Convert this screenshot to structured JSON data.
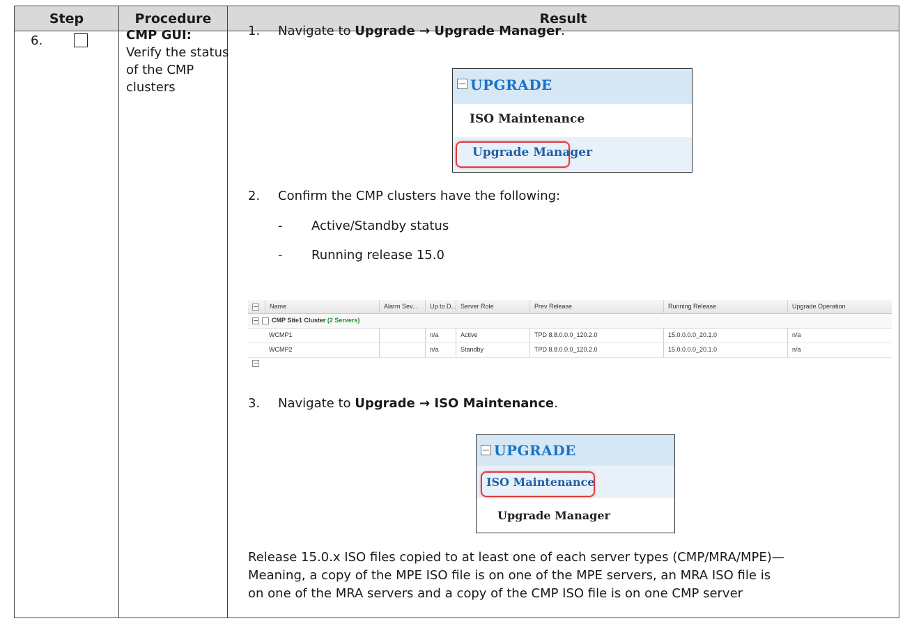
{
  "table": {
    "headers": {
      "step": "Step",
      "procedure": "Procedure",
      "result": "Result"
    }
  },
  "step": {
    "number": "6.",
    "procedure_bold": "CMP GUI:",
    "procedure_rest": "Verify the status of the CMP clusters"
  },
  "result": {
    "s1": {
      "num": "1.",
      "pre": "Navigate to ",
      "b1": "Upgrade",
      "arrow": " → ",
      "b2": "Upgrade Manager",
      "post": "."
    },
    "s2": {
      "num": "2.",
      "text": "Confirm the CMP clusters have the following:"
    },
    "bullets": [
      {
        "dash": "-",
        "text": "Active/Standby status"
      },
      {
        "dash": "-",
        "text": "Running release 15.0"
      }
    ],
    "s3": {
      "num": "3.",
      "pre": "Navigate to ",
      "b1": "Upgrade",
      "arrow": " → ",
      "b2": "ISO Maintenance",
      "post": "."
    },
    "note_lines": [
      "Release 15.0.x ISO files copied to at least one of each server types (CMP/MRA/MPE)—",
      "Meaning, a copy of the MPE ISO file is on one of the MPE servers, an MRA ISO file is",
      "on one of the MRA servers and a copy of the CMP ISO file is on one CMP server"
    ]
  },
  "menu1": {
    "header": "UPGRADE",
    "item1": "ISO Maintenance",
    "item2": "Upgrade Manager",
    "highlighted": "Upgrade Manager"
  },
  "menu2": {
    "header": "UPGRADE",
    "item1": "ISO Maintenance",
    "item2": "Upgrade Manager",
    "highlighted": "ISO Maintenance"
  },
  "grid": {
    "columns": [
      "Name",
      "Alarm Sev...",
      "Up to D...",
      "Server Role",
      "Prev Release",
      "Running Release",
      "Upgrade Operation"
    ],
    "cluster_name": "CMP Site1 Cluster",
    "cluster_count": "(2 Servers)",
    "rows": [
      {
        "name": "WCMP1",
        "alarm": "",
        "uptodate": "n/a",
        "role": "Active",
        "prev": "TPD 8.8.0.0.0_120.2.0",
        "running": "15.0.0.0.0_20.1.0",
        "op": "n/a"
      },
      {
        "name": "WCMP2",
        "alarm": "",
        "uptodate": "n/a",
        "role": "Standby",
        "prev": "TPD 8.8.0.0.0_120.2.0",
        "running": "15.0.0.0.0_20.1.0",
        "op": "n/a"
      }
    ]
  }
}
